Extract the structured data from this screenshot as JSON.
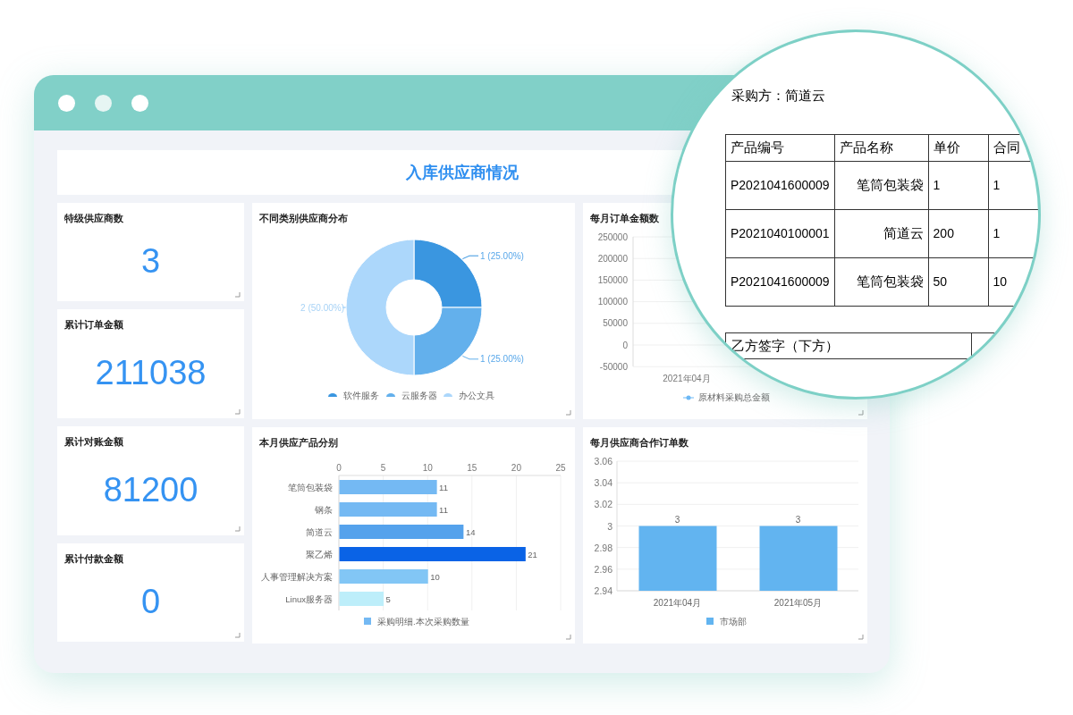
{
  "header": {
    "title": "入库供应商情况"
  },
  "kpis": [
    {
      "label": "特级供应商数",
      "value": "3"
    },
    {
      "label": "累计订单金额",
      "value": "211038"
    },
    {
      "label": "累计对账金额",
      "value": "81200"
    },
    {
      "label": "累计付款金额",
      "value": "0"
    }
  ],
  "pie_card": {
    "title": "不同类别供应商分布",
    "chart_data": {
      "type": "donut",
      "categories": [
        "软件服务",
        "云服务器",
        "办公文具"
      ],
      "values": [
        1,
        1,
        2
      ],
      "colors": [
        "#3a96e0",
        "#63b0ec",
        "#acd7fb"
      ],
      "value_labels": [
        "1 (25.00%)",
        "1 (25.00%)",
        "2 (50.00%)"
      ],
      "legend": "bottom"
    }
  },
  "line_card": {
    "title": "每月订单金额数",
    "y_ticks": [
      "250000",
      "200000",
      "150000",
      "100000",
      "50000",
      "0",
      "-50000"
    ],
    "x_label": "2021年04月",
    "legend": "原材料采购总金额"
  },
  "bar_card": {
    "title": "本月供应产品分别",
    "chart_data": {
      "type": "bar",
      "orientation": "horizontal",
      "categories": [
        "笔筒包装袋",
        "钢条",
        "简道云",
        "聚乙烯",
        "人事管理解决方案",
        "Linux服务器"
      ],
      "series": [
        {
          "name": "采购明细.本次采购数量",
          "values": [
            11,
            11,
            14,
            21,
            10,
            5
          ]
        }
      ],
      "colors": [
        "#74b9f3",
        "#74b9f3",
        "#55a2ec",
        "#0a63e6",
        "#82c6f5",
        "#bdeefa"
      ],
      "xlim": [
        0,
        25
      ],
      "xticks": [
        0,
        5,
        10,
        15,
        20,
        25
      ],
      "grid": true,
      "data_labels": true,
      "legend": "bottom"
    }
  },
  "column_card": {
    "title": "每月供应商合作订单数",
    "chart_data": {
      "type": "bar",
      "orientation": "vertical",
      "categories": [
        "2021年04月",
        "2021年05月"
      ],
      "series": [
        {
          "name": "市场部",
          "color": "#62b4f0",
          "values": [
            3,
            3
          ]
        }
      ],
      "ylim": [
        2.94,
        3.06
      ],
      "yticks": [
        {
          "value": 3.06,
          "label": "3.06"
        },
        {
          "value": 3.04,
          "label": "3.04"
        },
        {
          "value": 3.02,
          "label": "3.02"
        },
        {
          "value": 3,
          "label": "3"
        },
        {
          "value": 2.98,
          "label": "2.98"
        },
        {
          "value": 2.96,
          "label": "2.96"
        },
        {
          "value": 2.94,
          "label": "2.94"
        }
      ],
      "grid": true,
      "data_labels": true,
      "legend": "bottom"
    }
  },
  "magnifier": {
    "buyer": "采购方：简道云",
    "columns": [
      "产品编号",
      "产品名称",
      "单价",
      "合同"
    ],
    "rows": [
      [
        "P2021041600009",
        "笔筒包装袋",
        "1",
        "1"
      ],
      [
        "P2021040100001",
        "简道云",
        "200",
        "1"
      ],
      [
        "P2021041600009",
        "笔筒包装袋",
        "50",
        "10"
      ]
    ],
    "signature": "乙方签字（下方）"
  }
}
